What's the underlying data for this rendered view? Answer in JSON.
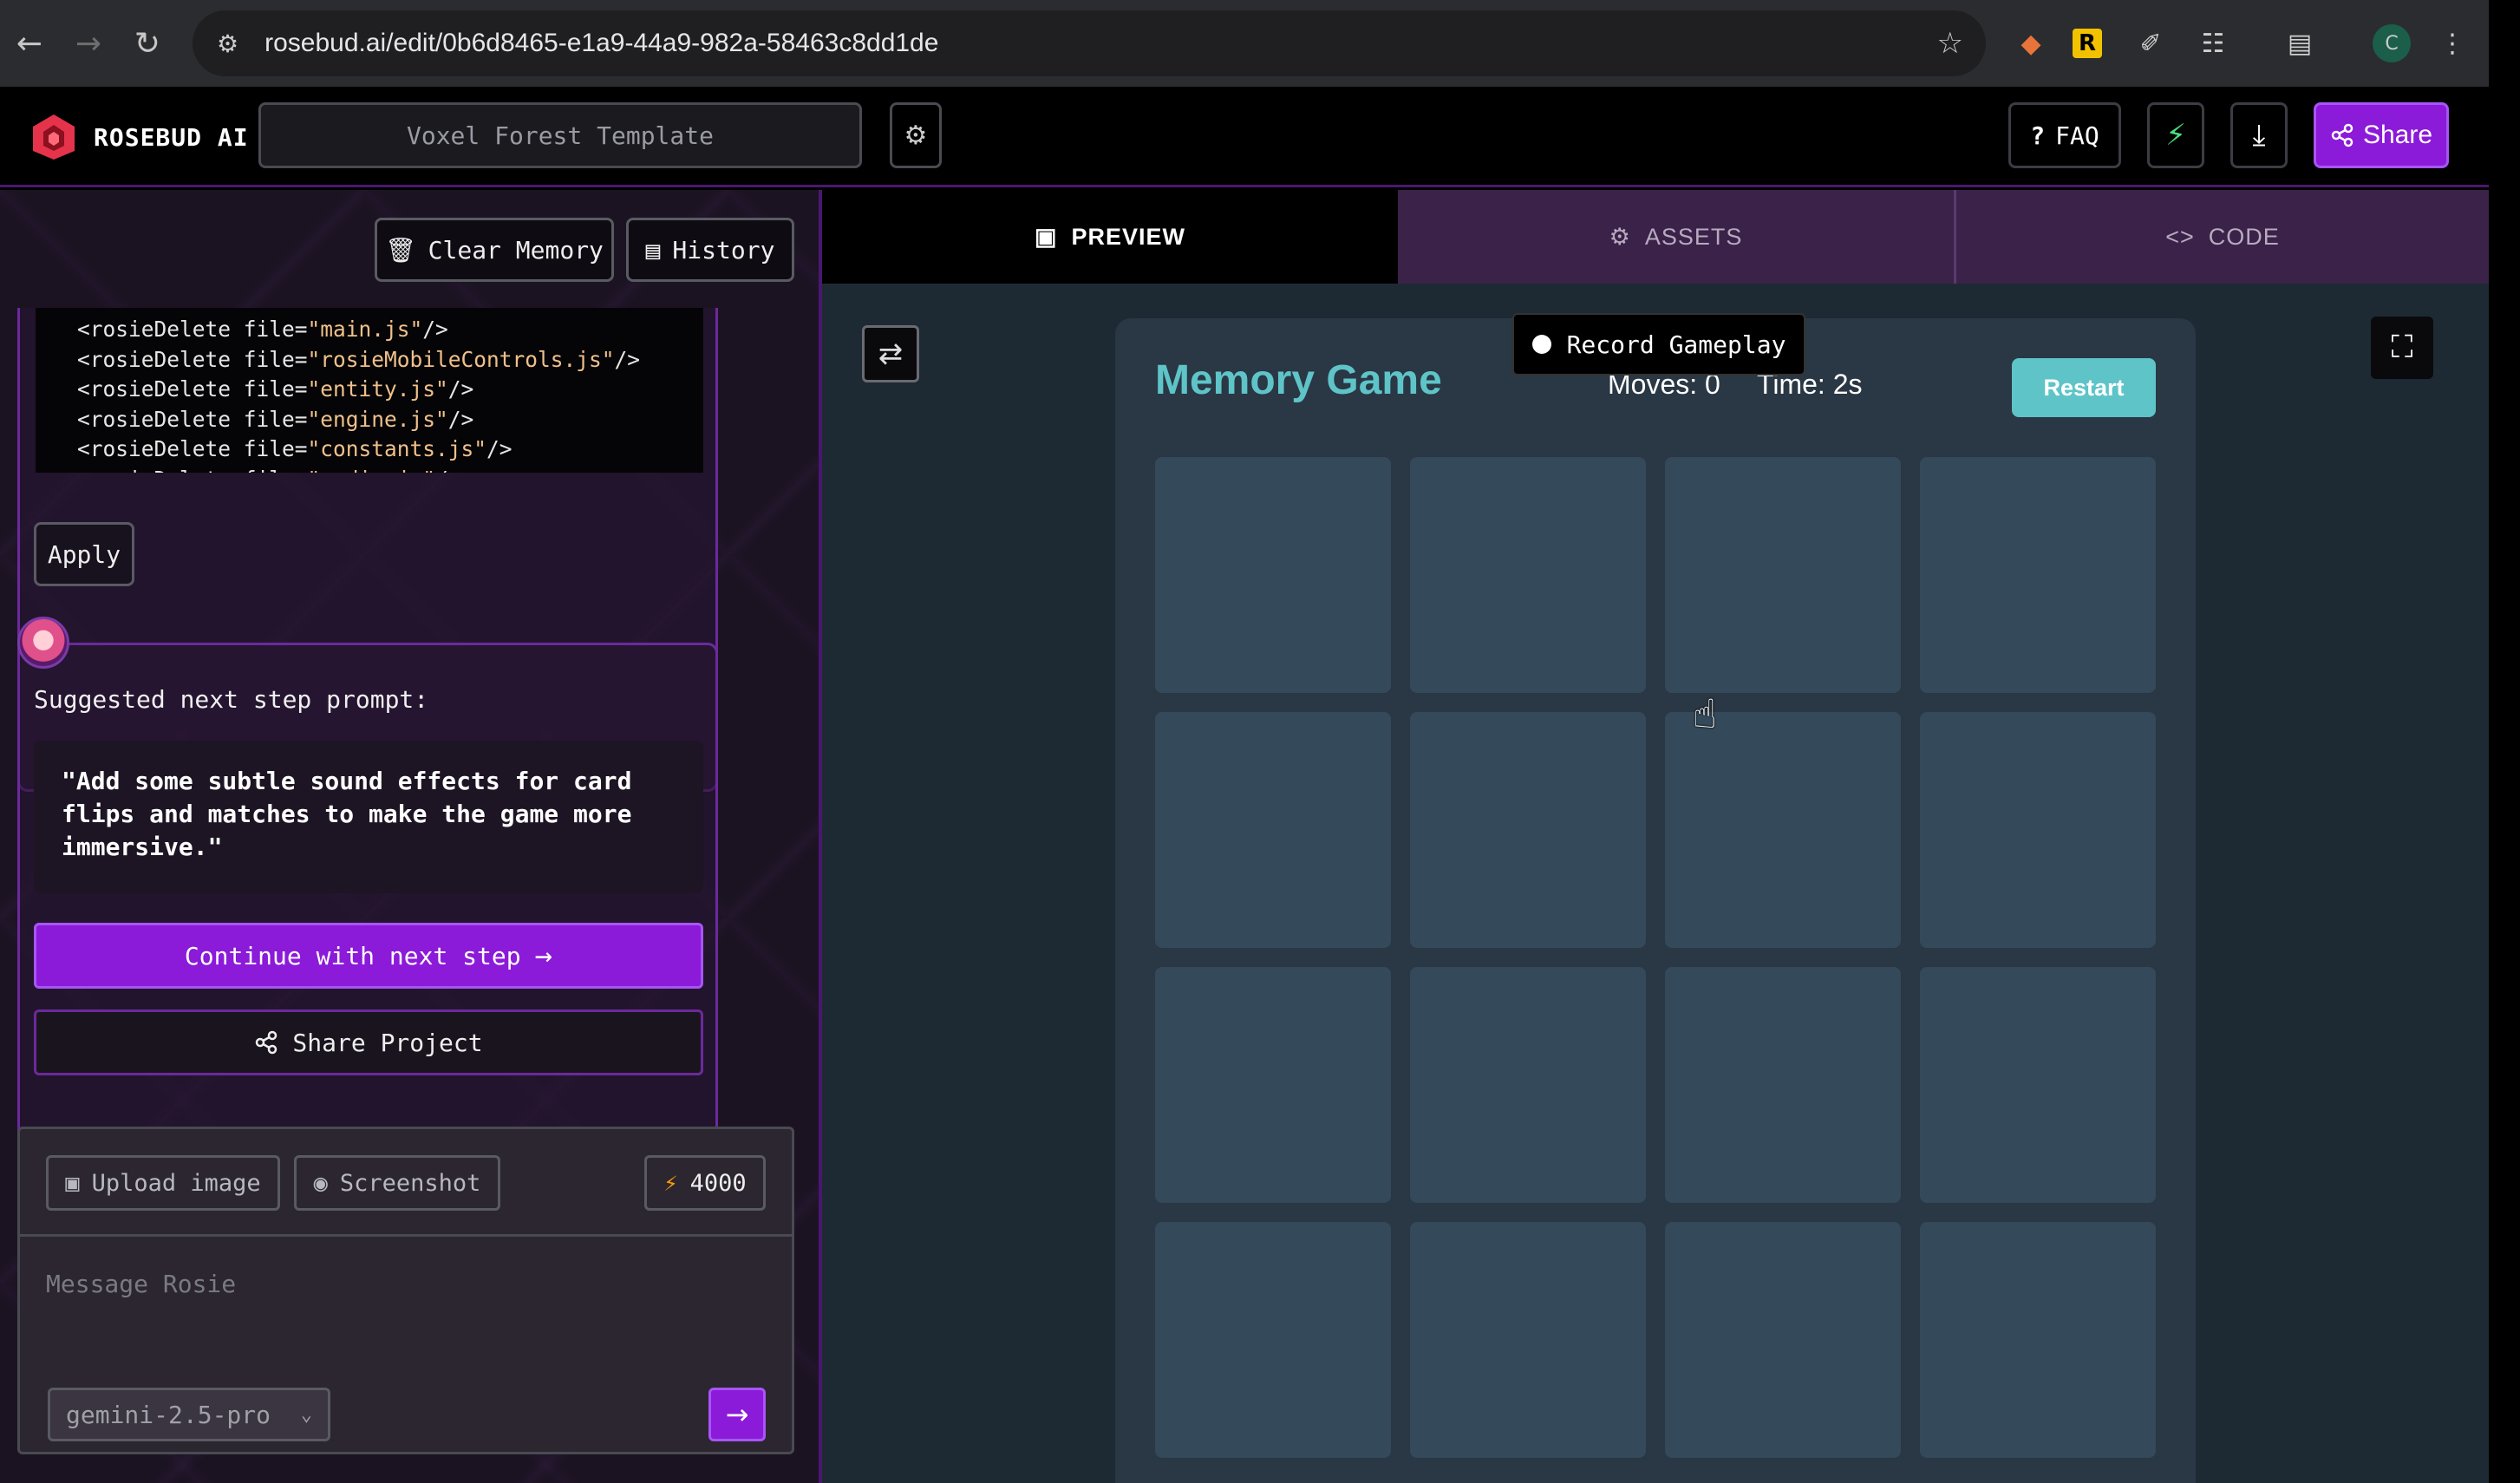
{
  "browser": {
    "url": "rosebud.ai/edit/0b6d8465-e1a9-44a9-982a-58463c8dd1de",
    "profile_initial": "C",
    "extension_r_label": "R"
  },
  "header": {
    "brand": "ROSEBUD AI",
    "project_title": "Voxel Forest Template",
    "faq_label": "FAQ",
    "share_label": "Share"
  },
  "left": {
    "clear_memory_label": "Clear Memory",
    "history_label": "History",
    "code_lines": [
      {
        "pre": "<rosieDelete file=",
        "str": "\"main.js\"",
        "post": "/>"
      },
      {
        "pre": "<rosieDelete file=",
        "str": "\"rosieMobileControls.js\"",
        "post": "/>"
      },
      {
        "pre": "<rosieDelete file=",
        "str": "\"entity.js\"",
        "post": "/>"
      },
      {
        "pre": "<rosieDelete file=",
        "str": "\"engine.js\"",
        "post": "/>"
      },
      {
        "pre": "<rosieDelete file=",
        "str": "\"constants.js\"",
        "post": "/>"
      },
      {
        "pre": "<rosieDelete file=",
        "str": "\"audio.js\"",
        "post": "/>"
      }
    ],
    "apply_label": "Apply",
    "suggest_label": "Suggested next step prompt:",
    "suggest_text": "\"Add some subtle sound effects for card flips and matches to make the game more immersive.\"",
    "continue_label": "Continue with next step",
    "share_project_label": "Share Project",
    "upload_label": "Upload image",
    "screenshot_label": "Screenshot",
    "credits": "4000",
    "message_placeholder": "Message Rosie",
    "model": "gemini-2.5-pro"
  },
  "right": {
    "tabs": [
      {
        "label": "PREVIEW",
        "active": true
      },
      {
        "label": "ASSETS",
        "active": false
      },
      {
        "label": "CODE",
        "active": false
      }
    ],
    "record_label": "Record Gameplay",
    "game": {
      "title": "Memory Game",
      "moves": "Moves: 0",
      "time": "Time: 2s",
      "restart_label": "Restart",
      "card_count": 16
    }
  },
  "colors": {
    "accent_purple": "#8b1ad9",
    "teal": "#5ec4c8",
    "card": "#34495a"
  },
  "icons": [
    "back-icon",
    "forward-icon",
    "reload-icon",
    "site-info-icon",
    "star-icon",
    "extensions-icon",
    "menu-icon",
    "gear-icon",
    "question-icon",
    "bolt-icon",
    "download-icon",
    "share-icon",
    "trash-icon",
    "history-icon",
    "arrow-right-icon",
    "image-icon",
    "camera-icon",
    "chevron-down-icon",
    "swap-icon",
    "fullscreen-icon",
    "code-icon",
    "cursor-hand-icon"
  ]
}
